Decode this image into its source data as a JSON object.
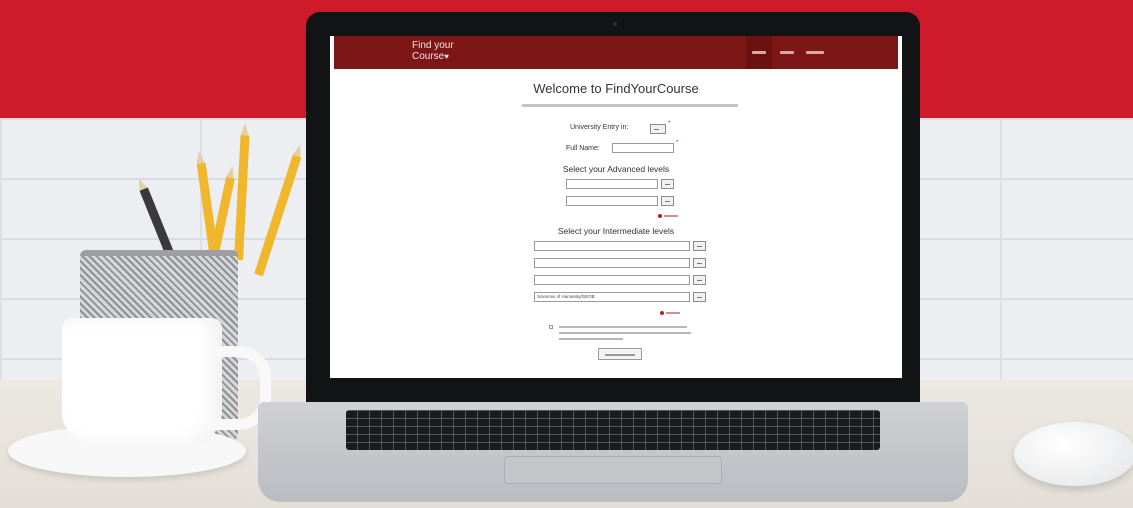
{
  "site": {
    "logo_line1": "Find your",
    "logo_line2": "Course",
    "logo_heart": "♥"
  },
  "page": {
    "heading": "Welcome to FindYourCourse"
  },
  "form": {
    "entry_label": "University Entry in:",
    "name_label": "Full Name:",
    "advanced_title": "Select your Advanced levels",
    "intermediate_title": "Select your Intermediate levels",
    "advanced_fields": [
      "",
      ""
    ],
    "intermediate_fields": [
      "",
      "",
      "",
      "Sciences of Humanity/GEOB"
    ]
  },
  "colors": {
    "nav": "#7c1617",
    "accent": "#b32020",
    "wall": "#cf1a2c"
  }
}
